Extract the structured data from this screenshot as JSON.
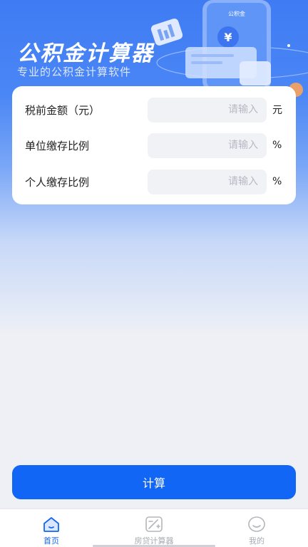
{
  "header": {
    "title": "公积金计算器",
    "subtitle": "专业的公积金计算软件",
    "illustration_text": "公积金"
  },
  "form": {
    "rows": [
      {
        "label": "税前金额（元）",
        "placeholder": "请输入",
        "unit": "元"
      },
      {
        "label": "单位缴存比例",
        "placeholder": "请输入",
        "unit": "%"
      },
      {
        "label": "个人缴存比例",
        "placeholder": "请输入",
        "unit": "%"
      }
    ]
  },
  "actions": {
    "calculate_label": "计算"
  },
  "tabbar": {
    "tabs": [
      {
        "label": "首页",
        "icon": "home-icon",
        "active": true
      },
      {
        "label": "房贷计算器",
        "icon": "calculator-icon",
        "active": false
      },
      {
        "label": "我的",
        "icon": "profile-icon",
        "active": false
      }
    ]
  },
  "colors": {
    "accent": "#1266f5",
    "header_gradient_top": "#3f7cf4",
    "background": "#eef0f6",
    "inactive_tab": "#a8abb3"
  }
}
